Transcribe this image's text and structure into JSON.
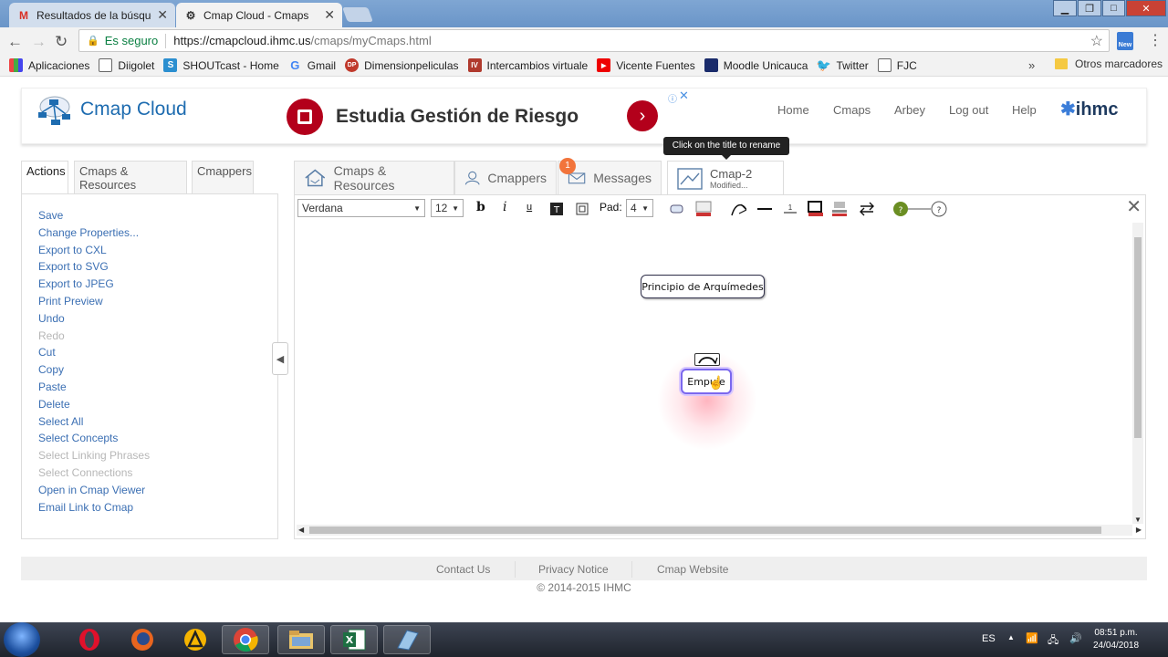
{
  "browser": {
    "tabs": [
      {
        "title": "Resultados de la búsque",
        "active": false
      },
      {
        "title": "Cmap Cloud - Cmaps",
        "active": true
      }
    ],
    "url_secure_label": "Es seguro",
    "url_host": "https://cmapcloud.ihmc.us",
    "url_path": "/cmaps/myCmaps.html",
    "bookmarks": [
      {
        "label": "Aplicaciones",
        "icon": "apps-icon"
      },
      {
        "label": "Diigolet",
        "icon": "page-icon"
      },
      {
        "label": "SHOUTcast - Home",
        "icon": "shoutcast-icon"
      },
      {
        "label": "Gmail",
        "icon": "google-icon"
      },
      {
        "label": "Dimensionpeliculas",
        "icon": "dp-icon"
      },
      {
        "label": "Intercambios virtuale",
        "icon": "iv-icon"
      },
      {
        "label": "Vicente Fuentes",
        "icon": "youtube-icon"
      },
      {
        "label": "Moodle Unicauca",
        "icon": "moodle-icon"
      },
      {
        "label": "Twitter",
        "icon": "twitter-icon"
      },
      {
        "label": "FJC",
        "icon": "page-icon"
      }
    ],
    "other_bookmarks": "Otros marcadores",
    "ext_label": "New"
  },
  "header": {
    "logo_text": "Cmap Cloud",
    "ad_text": "Estudia Gestión de Riesgo",
    "nav": [
      "Home",
      "Cmaps",
      "Arbey",
      "Log out",
      "Help"
    ],
    "brand": "ihmc"
  },
  "left_tabs": [
    "Actions",
    "Cmaps & Resources",
    "Cmappers"
  ],
  "actions": [
    {
      "label": "Save",
      "enabled": true
    },
    {
      "label": "Change Properties...",
      "enabled": true
    },
    {
      "label": "Export to CXL",
      "enabled": true
    },
    {
      "label": "Export to SVG",
      "enabled": true
    },
    {
      "label": "Export to JPEG",
      "enabled": true
    },
    {
      "label": "Print Preview",
      "enabled": true
    },
    {
      "label": "Undo",
      "enabled": true
    },
    {
      "label": "Redo",
      "enabled": false
    },
    {
      "label": "Cut",
      "enabled": true
    },
    {
      "label": "Copy",
      "enabled": true
    },
    {
      "label": "Paste",
      "enabled": true
    },
    {
      "label": "Delete",
      "enabled": true
    },
    {
      "label": "Select All",
      "enabled": true
    },
    {
      "label": "Select Concepts",
      "enabled": true
    },
    {
      "label": "Select Linking Phrases",
      "enabled": false
    },
    {
      "label": "Select Connections",
      "enabled": false
    },
    {
      "label": "Open in Cmap Viewer",
      "enabled": true
    },
    {
      "label": "Email Link to Cmap",
      "enabled": true
    }
  ],
  "right_tabs": {
    "cmaps_resources": "Cmaps & Resources",
    "cmappers": "Cmappers",
    "messages": "Messages",
    "messages_badge": "1",
    "cmap_title": "Cmap-2",
    "cmap_status": "Modified..."
  },
  "tooltip": "Click on the title to rename",
  "editor": {
    "font": "Verdana",
    "size": "12",
    "pad_label": "Pad:",
    "pad_value": "4",
    "bold": "b",
    "italic": "i",
    "underline": "u",
    "line_width_label": "1"
  },
  "concepts": [
    {
      "label": "Principio de Arquímedes"
    },
    {
      "label": "Empuje"
    }
  ],
  "footer": {
    "links": [
      "Contact Us",
      "Privacy Notice",
      "Cmap Website"
    ],
    "copyright": "© 2014-2015 IHMC"
  },
  "taskbar": {
    "lang": "ES",
    "time": "08:51 p.m.",
    "date": "24/04/2018"
  }
}
